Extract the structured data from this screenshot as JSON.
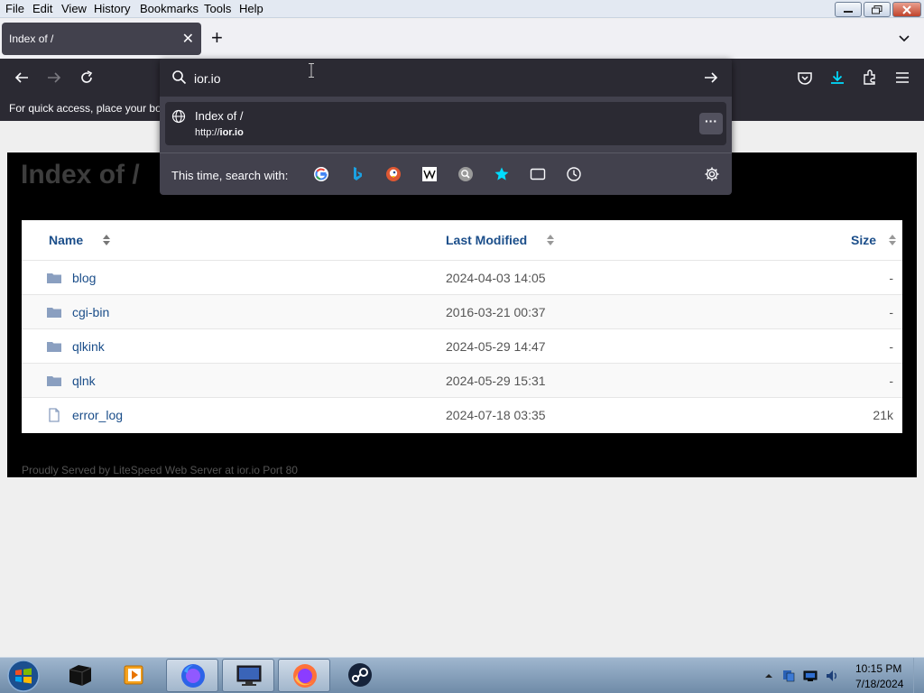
{
  "menubar": {
    "items": [
      "File",
      "Edit",
      "View",
      "History",
      "Bookmarks",
      "Tools",
      "Help"
    ]
  },
  "tab": {
    "title": "Index of /",
    "close_glyph": "✕",
    "new_tab_glyph": "+"
  },
  "urlbar": {
    "value": "ior.io",
    "result_title": "Index of /",
    "result_url_prefix": "http://",
    "result_url_host": "ior.io",
    "more_glyph": "···",
    "search_with_label": "This time, search with:"
  },
  "bookmarks_bar": {
    "hint": "For quick access, place your boo"
  },
  "page": {
    "title": "Index of /",
    "columns": {
      "name": "Name",
      "modified": "Last Modified",
      "size": "Size"
    },
    "rows": [
      {
        "name": "blog",
        "modified": "2024-04-03 14:05",
        "size": "-",
        "type": "folder"
      },
      {
        "name": "cgi-bin",
        "modified": "2016-03-21 00:37",
        "size": "-",
        "type": "folder"
      },
      {
        "name": "qlkink",
        "modified": "2024-05-29 14:47",
        "size": "-",
        "type": "folder"
      },
      {
        "name": "qlnk",
        "modified": "2024-05-29 15:31",
        "size": "-",
        "type": "folder"
      },
      {
        "name": "error_log",
        "modified": "2024-07-18 03:35",
        "size": "21k",
        "type": "file"
      }
    ],
    "footer": "Proudly Served by LiteSpeed Web Server at ior.io Port 80"
  },
  "taskbar": {
    "time": "10:15 PM",
    "date": "7/18/2024"
  },
  "colors": {
    "toolbar_dark": "#2b2a33",
    "popup": "#42414d",
    "link": "#1b4e8a",
    "download_accent": "#00ddff"
  }
}
